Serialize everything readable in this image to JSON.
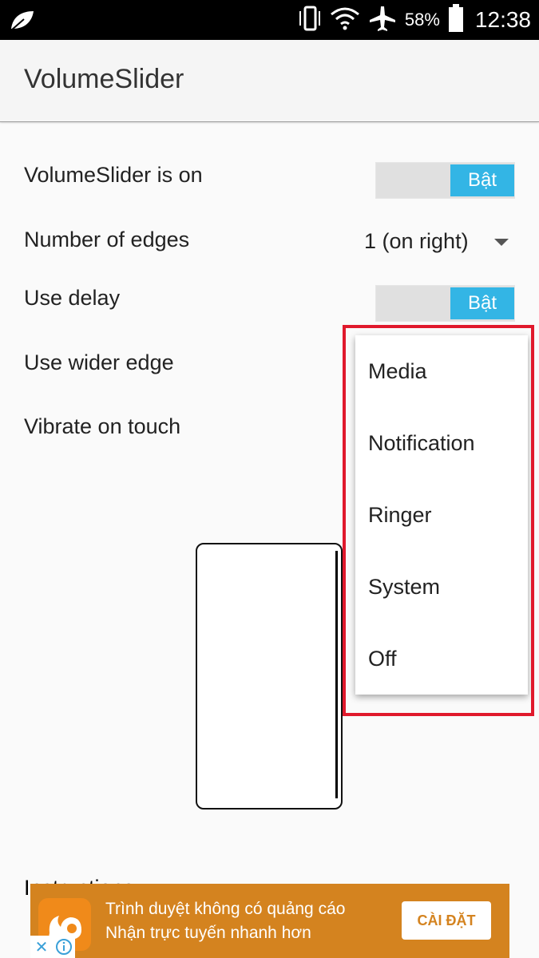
{
  "status_bar": {
    "battery_text": "58%",
    "time": "12:38",
    "icons": [
      "leaf-icon",
      "vibrate-icon",
      "wifi-icon",
      "airplane-icon",
      "battery-icon"
    ]
  },
  "app_bar": {
    "title": "VolumeSlider"
  },
  "settings": {
    "enabled_label": "VolumeSlider is on",
    "enabled_toggle": "Bật",
    "edges_label": "Number of edges",
    "edges_value": "1 (on right)",
    "delay_label": "Use delay",
    "delay_toggle": "Bật",
    "wider_label": "Use wider edge",
    "vibrate_label": "Vibrate on touch"
  },
  "dropdown": {
    "items": [
      "Media",
      "Notification",
      "Ringer",
      "System",
      "Off"
    ]
  },
  "instructions_label": "Instructions",
  "ad": {
    "line1": "Trình duyệt không có quảng cáo",
    "line2": "Nhận trực tuyến nhanh hơn",
    "button": "CÀI ĐẶT"
  },
  "colors": {
    "accent": "#33b5e5",
    "highlight": "#e0192c",
    "ad_bg": "#d4831f"
  }
}
